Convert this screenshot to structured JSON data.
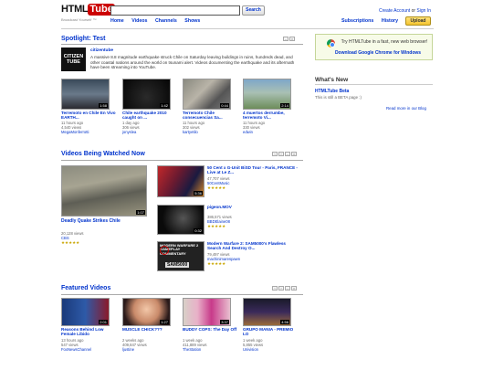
{
  "header": {
    "logo_text": "HTML",
    "logo_badge": "Tube",
    "tagline": "Broadcast Yourself ™",
    "search_placeholder": "",
    "search_button": "Search",
    "nav": [
      "Home",
      "Videos",
      "Channels",
      "Shows"
    ],
    "create_account": "Create Account",
    "or": "or",
    "sign_in": "Sign In",
    "subscriptions": "Subscriptions",
    "history": "History",
    "upload": "Upload"
  },
  "spotlight": {
    "title": "Spotlight: Test",
    "channel_logo": "CITIZEN TUBE",
    "channel_name": "citizentube",
    "description": "A massive 8.8 magnitude earthquake struck Chile on Saturday leaving buildings in ruins, hundreds dead, and other coastal nations around the world on tsunami alert. Videos documenting the earthquake and its aftermath have been streaming into YouTube.",
    "videos": [
      {
        "title": "Terremoto en Chile En Vivo EARTH...",
        "age": "11 hours ago",
        "views": "4,540 views",
        "user": "MegaMonferrotti",
        "duration": "1:58"
      },
      {
        "title": "Chile earthquake 2010 caught on ...",
        "age": "1 day ago",
        "views": "306 views",
        "user": "jonyslea",
        "duration": "1:42"
      },
      {
        "title": "Terremoto Chile consecuencias Sa...",
        "age": "11 hours ago",
        "views": "302 views",
        "user": "kartyetilo",
        "duration": "0:44"
      },
      {
        "title": "4 muertos derrumbe, terremoto Vi...",
        "age": "11 hours ago",
        "views": "330 views",
        "user": "edwin",
        "duration": "2:14"
      }
    ]
  },
  "watched": {
    "title": "Videos Being Watched Now",
    "main": {
      "title": "Deadly Quake Strikes Chile",
      "views": "20,128 views",
      "user": "CBS",
      "duration": "1:07",
      "stars": "★★★★★"
    },
    "list": [
      {
        "title": "50 Cent x G-Unit BiSD Tour - Paris, FRANCE - Live at Le Z...",
        "views": "47,707 views",
        "user": "50CentMusic",
        "duration": "5:36",
        "stars": "★★★★★"
      },
      {
        "title": "pigeon.MOV",
        "views": "386,571 views",
        "user": "BBDElaine08",
        "duration": "0:32",
        "stars": "★★★★★"
      },
      {
        "title": "Modern Warfare 2: SAM5000's Flawless Search And Destroy O...",
        "views": "79,497 views",
        "user": "machinimarespawn",
        "duration": "",
        "stars": "★★★★★",
        "thumb_text_1": "MODERN WARFARE 2",
        "thumb_text_2": "GAMEPLAY COMMENTARY",
        "thumb_text_3": "SAM5000"
      }
    ]
  },
  "featured": {
    "title": "Featured Videos",
    "videos": [
      {
        "title": "Reasons Behind Low Female Libido",
        "age": "13 hours ago",
        "views": "547 views",
        "user": "FoxNewsChannel",
        "duration": "2:01"
      },
      {
        "title": "MUSCLE CHICK???",
        "age": "2 weeks ago",
        "views": "409,847 views",
        "user": "ljustine",
        "duration": "1:27"
      },
      {
        "title": "BUDDY COPS: The Day Off",
        "age": "1 week ago",
        "views": "411,889 views",
        "user": "TheStation",
        "duration": "3:37"
      },
      {
        "title": "GRUPO MANIA - PREMIO LO",
        "age": "1 week ago",
        "views": "5,855 views",
        "user": "Univision",
        "duration": "4:56"
      }
    ]
  },
  "sidebar": {
    "promo_text": "Try HTMLTube in a fast, new web browser!",
    "promo_link": "Download Google Chrome for Windows",
    "whats_new_title": "What's New",
    "beta_title": "HTMLTube Beta",
    "beta_desc": "This is still a BETA page :)",
    "read_more": "Read more in our Blog"
  }
}
